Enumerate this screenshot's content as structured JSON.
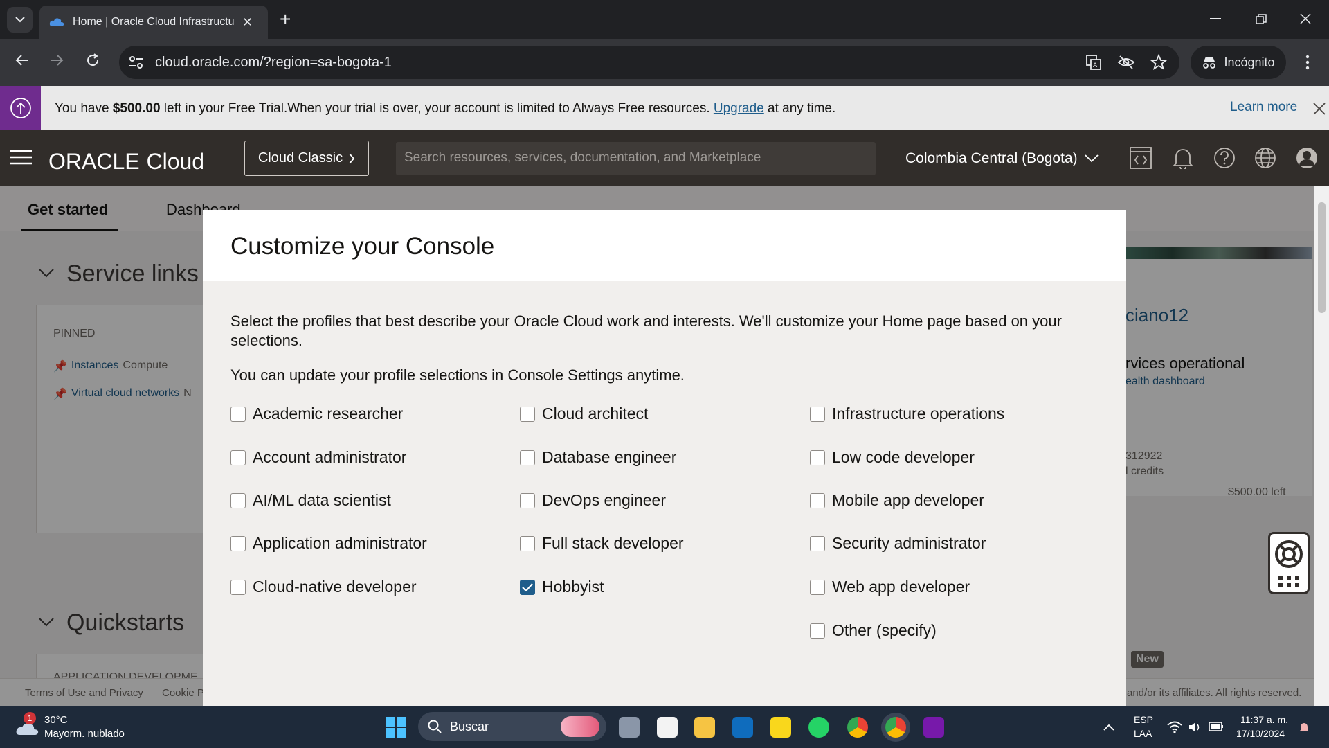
{
  "browser": {
    "tab_title": "Home | Oracle Cloud Infrastructure",
    "url": "cloud.oracle.com/?region=sa-bogota-1",
    "incognito_label": "Incógnito"
  },
  "banner": {
    "text_before": "You have ",
    "amount": "$500.00",
    "text_middle": " left in your Free Trial.When your trial is over, your account is limited to Always Free resources. ",
    "upgrade": "Upgrade",
    "text_after": " at any time.",
    "learn_more": "Learn more"
  },
  "header": {
    "logo_oracle": "ORACLE",
    "logo_cloud": "Cloud",
    "cloud_classic": "Cloud Classic",
    "search_placeholder": "Search resources, services, documentation, and Marketplace",
    "region": "Colombia Central (Bogota)"
  },
  "page": {
    "tabs": [
      "Get started",
      "Dashboard"
    ],
    "service_links": "Service links",
    "pinned": "PINNED",
    "pinned_items": [
      {
        "name": "Instances",
        "service": "Compute"
      },
      {
        "name": "Virtual cloud networks",
        "service": "N"
      }
    ],
    "quickstarts": "Quickstarts",
    "quickstart_category": "APPLICATION DEVELOPME",
    "right_username": "ciano12",
    "right_status": "rvices operational",
    "right_health_link": "ealth dashboard",
    "right_account": "312922",
    "right_credits": "l credits",
    "right_left": "$500.00 left",
    "new_badge": "New",
    "footer_terms": "Terms of Use and Privacy",
    "footer_cookie": "Cookie P",
    "footer_copyright": "and/or its affiliates. All rights reserved."
  },
  "modal": {
    "title": "Customize your Console",
    "description": "Select the profiles that best describe your Oracle Cloud work and interests. We'll customize your Home page based on your selections.",
    "note": "You can update your profile selections in Console Settings anytime.",
    "options": [
      {
        "label": "Academic researcher",
        "checked": false
      },
      {
        "label": "Account administrator",
        "checked": false
      },
      {
        "label": "AI/ML data scientist",
        "checked": false
      },
      {
        "label": "Application administrator",
        "checked": false
      },
      {
        "label": "Cloud-native developer",
        "checked": false
      },
      {
        "label": "Cloud architect",
        "checked": false
      },
      {
        "label": "Database engineer",
        "checked": false
      },
      {
        "label": "DevOps engineer",
        "checked": false
      },
      {
        "label": "Full stack developer",
        "checked": false
      },
      {
        "label": "Hobbyist",
        "checked": true
      },
      {
        "label": "Infrastructure operations",
        "checked": false
      },
      {
        "label": "Low code developer",
        "checked": false
      },
      {
        "label": "Mobile app developer",
        "checked": false
      },
      {
        "label": "Security administrator",
        "checked": false
      },
      {
        "label": "Web app developer",
        "checked": false
      },
      {
        "label": "Other (specify)",
        "checked": false
      }
    ]
  },
  "taskbar": {
    "temperature": "30°C",
    "weather": "Mayorm. nublado",
    "weather_badge": "1",
    "search": "Buscar",
    "lang1": "ESP",
    "lang2": "LAA",
    "time": "11:37 a. m.",
    "date": "17/10/2024"
  },
  "colors": {
    "oracle_header": "#312d2a",
    "banner_accent": "#6f2c8e",
    "link": "#1f5d8b",
    "checkbox_checked": "#1f5d8b"
  }
}
